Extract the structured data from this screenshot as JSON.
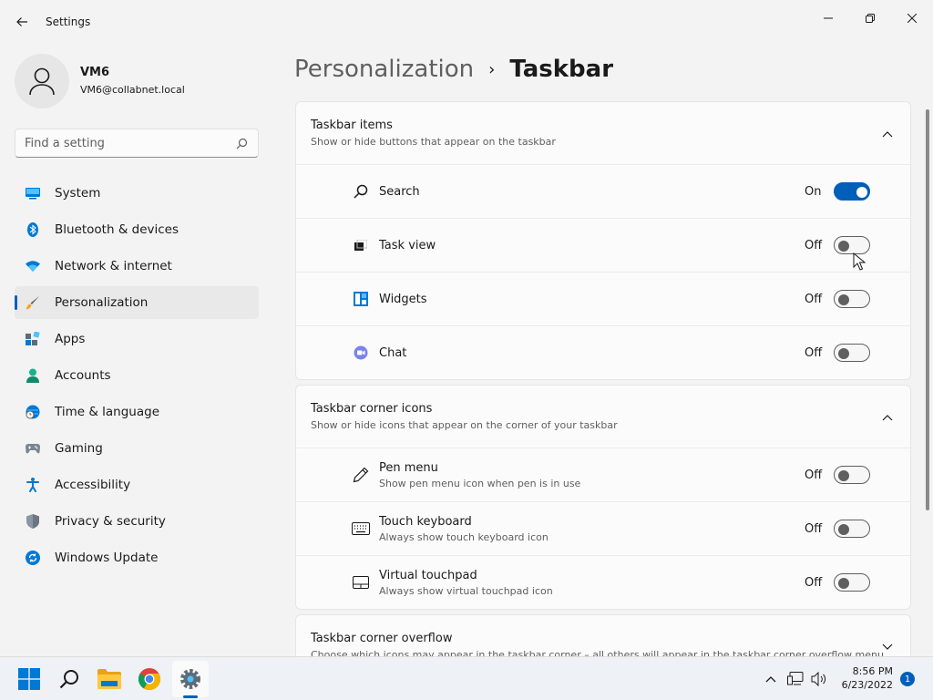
{
  "window": {
    "title": "Settings"
  },
  "user": {
    "name": "VM6",
    "email": "VM6@collabnet.local"
  },
  "search": {
    "placeholder": "Find a setting"
  },
  "sidebar": {
    "items": [
      {
        "label": "System",
        "icon": "monitor-icon"
      },
      {
        "label": "Bluetooth & devices",
        "icon": "bluetooth-icon"
      },
      {
        "label": "Network & internet",
        "icon": "wifi-icon"
      },
      {
        "label": "Personalization",
        "icon": "brush-icon",
        "active": true
      },
      {
        "label": "Apps",
        "icon": "apps-icon"
      },
      {
        "label": "Accounts",
        "icon": "person-icon"
      },
      {
        "label": "Time & language",
        "icon": "clock-globe-icon"
      },
      {
        "label": "Gaming",
        "icon": "gamepad-icon"
      },
      {
        "label": "Accessibility",
        "icon": "accessibility-icon"
      },
      {
        "label": "Privacy & security",
        "icon": "shield-icon"
      },
      {
        "label": "Windows Update",
        "icon": "update-icon"
      }
    ]
  },
  "breadcrumb": {
    "parent": "Personalization",
    "separator": "›",
    "current": "Taskbar"
  },
  "sections": {
    "taskbar_items": {
      "title": "Taskbar items",
      "subtitle": "Show or hide buttons that appear on the taskbar",
      "rows": [
        {
          "label": "Search",
          "state": "On"
        },
        {
          "label": "Task view",
          "state": "Off"
        },
        {
          "label": "Widgets",
          "state": "Off"
        },
        {
          "label": "Chat",
          "state": "Off"
        }
      ]
    },
    "corner_icons": {
      "title": "Taskbar corner icons",
      "subtitle": "Show or hide icons that appear on the corner of your taskbar",
      "rows": [
        {
          "label": "Pen menu",
          "sub": "Show pen menu icon when pen is in use",
          "state": "Off"
        },
        {
          "label": "Touch keyboard",
          "sub": "Always show touch keyboard icon",
          "state": "Off"
        },
        {
          "label": "Virtual touchpad",
          "sub": "Always show virtual touchpad icon",
          "state": "Off"
        }
      ]
    },
    "corner_overflow": {
      "title": "Taskbar corner overflow",
      "subtitle": "Choose which icons may appear in the taskbar corner – all others will appear in the taskbar corner overflow menu"
    }
  },
  "taskbar": {
    "time": "8:56 PM",
    "date": "6/23/2022",
    "notification_count": "1"
  },
  "colors": {
    "accent": "#005fb8"
  }
}
